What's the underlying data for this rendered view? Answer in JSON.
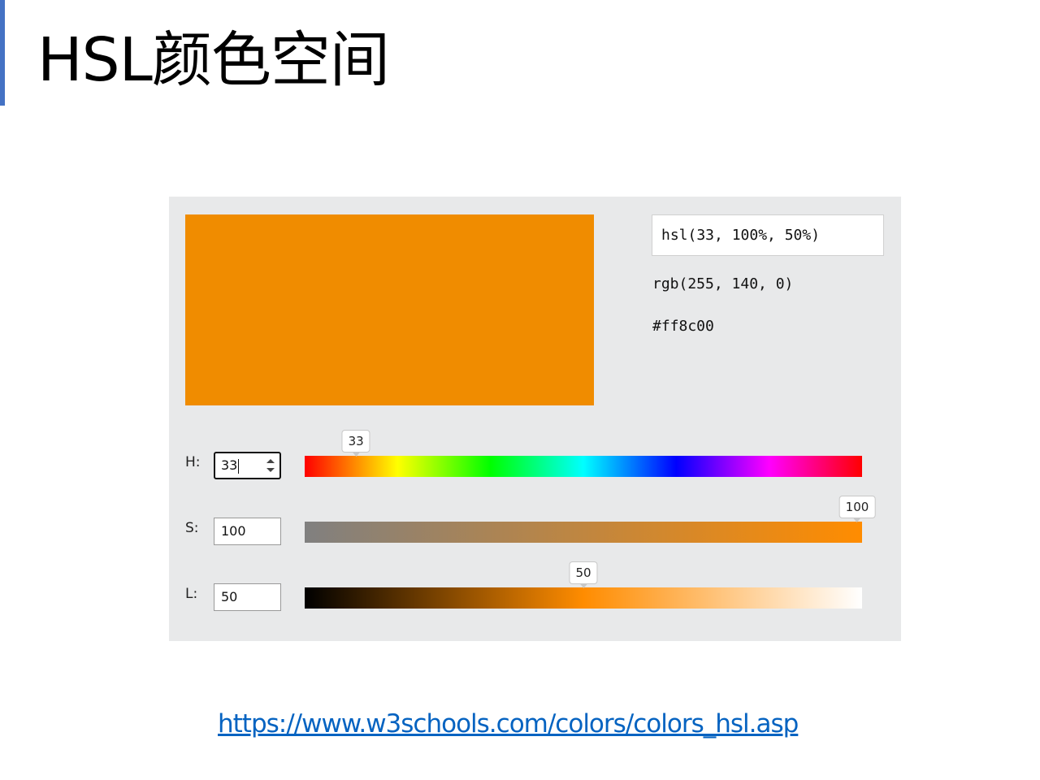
{
  "slide": {
    "title": "HSL颜色空间",
    "link": "https://www.w3schools.com/colors/colors_hsl.asp",
    "accent_color": "#4472c4"
  },
  "picker": {
    "swatch_color": "#f08c00",
    "hsl_value": "hsl(33, 100%, 50%)",
    "rgb_value": "rgb(255, 140, 0)",
    "hex_value": "#ff8c00",
    "controls": [
      {
        "label": "H:",
        "value": "33",
        "bubble": "33",
        "fraction": 0.092
      },
      {
        "label": "S:",
        "value": "100",
        "bubble": "100",
        "fraction": 1.0
      },
      {
        "label": "L:",
        "value": "50",
        "bubble": "50",
        "fraction": 0.5
      }
    ]
  }
}
